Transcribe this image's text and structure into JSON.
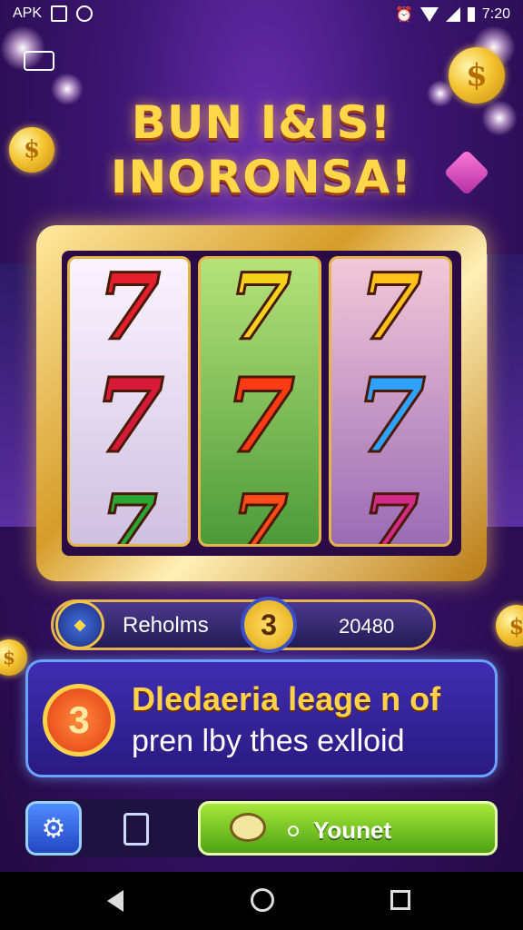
{
  "status_bar": {
    "left_text": "APK",
    "time": "7:20"
  },
  "title": {
    "line1": "BUN I&IS!",
    "line2": "INORONSA!"
  },
  "reels": [
    {
      "symbols": [
        "7",
        "7",
        "7"
      ]
    },
    {
      "symbols": [
        "7",
        "7",
        "7"
      ]
    },
    {
      "symbols": [
        "7",
        "7",
        "7"
      ]
    }
  ],
  "info_bar": {
    "label": "Reholms",
    "badge": "3",
    "value": "20480"
  },
  "banner": {
    "badge": "3",
    "line1": "Dledaeria leage n of",
    "line2": "pren lby thes exlloid"
  },
  "bottom": {
    "play_label": "Younet"
  },
  "colors": {
    "gold": "#ffd84a",
    "purple": "#3b1672",
    "green": "#7ccf1c"
  }
}
